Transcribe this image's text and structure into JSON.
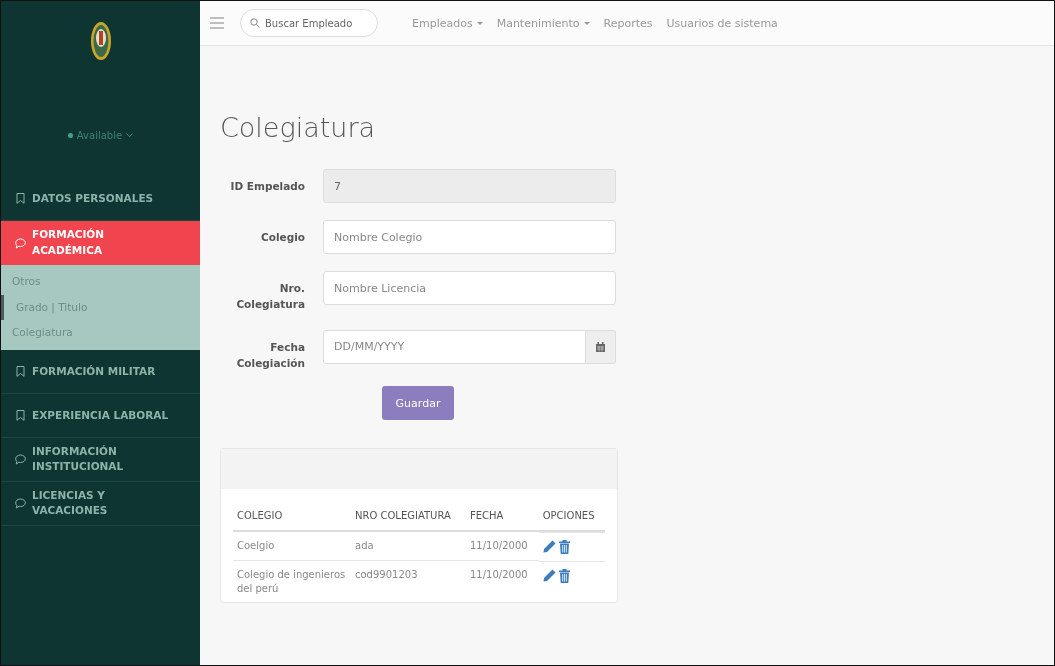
{
  "sidebar": {
    "status": "Available",
    "items": [
      {
        "label": "DATOS PERSONALES",
        "kind": "bookmark",
        "selected": false
      },
      {
        "label": "FORMACIÓN ACADÉMICA",
        "kind": "chat",
        "selected": true,
        "expanded": true,
        "children": [
          {
            "label": "Otros",
            "selected": false
          },
          {
            "label": "Grado | Titulo",
            "selected": true
          },
          {
            "label": "Colegiatura",
            "selected": false
          }
        ]
      },
      {
        "label": "FORMACIÓN MILITAR",
        "kind": "bookmark",
        "selected": false
      },
      {
        "label": "EXPERIENCIA LABORAL",
        "kind": "bookmark",
        "selected": false
      },
      {
        "label": "INFORMACIÓN INSTITUCIONAL",
        "kind": "chat",
        "selected": false
      },
      {
        "label": "LICENCIAS Y VACACIONES",
        "kind": "chat",
        "selected": false
      }
    ]
  },
  "topbar": {
    "search": {
      "placeholder": "Buscar Empleado"
    },
    "menu": [
      {
        "label": "Empleados",
        "dropdown": true
      },
      {
        "label": "Mantenimiento",
        "dropdown": true
      },
      {
        "label": "Reportes",
        "dropdown": false
      },
      {
        "label": "Usuarios de sistema",
        "dropdown": false
      }
    ]
  },
  "page_title": "Colegiatura",
  "form": {
    "fields": [
      {
        "label": "ID Empelado",
        "value": "7",
        "disabled": true,
        "kind": "text"
      },
      {
        "label": "Colegio",
        "placeholder": "Nombre Colegio",
        "disabled": false,
        "kind": "text"
      },
      {
        "label": "Nro. Colegiatura",
        "placeholder": "Nombre Licencia",
        "disabled": false,
        "kind": "text"
      },
      {
        "label": "Fecha Colegiación",
        "placeholder": "DD/MM/YYYY",
        "disabled": false,
        "kind": "date"
      }
    ],
    "submit": "Guardar"
  },
  "table": {
    "columns": [
      "COLEGIO",
      "NRO COLEGIATURA",
      "FECHA",
      "OPCIONES"
    ],
    "rows": [
      [
        "Coelgio",
        "ada",
        "11/10/2000"
      ],
      [
        "Colegio de ingenieros del perú",
        "cod9901203",
        "11/10/2000"
      ]
    ]
  }
}
